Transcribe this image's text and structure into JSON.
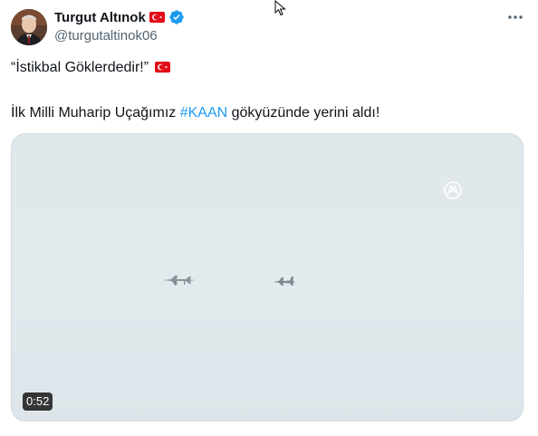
{
  "author": {
    "display_name": "Turgut Altınok",
    "handle": "@turgutaltinok06"
  },
  "tweet": {
    "line1": "“İstikbal Göklerdedir!”",
    "line2_prefix": "İlk Milli Muharip Uçağımız ",
    "hashtag": "#KAAN",
    "line2_suffix": " gökyüzünde yerini aldı!"
  },
  "media": {
    "duration": "0:52",
    "watermark_icon": "aa-logo-icon"
  },
  "icons": {
    "flag": "turkey-flag-icon",
    "verified": "verified-badge-icon",
    "more": "more-options-icon"
  },
  "colors": {
    "link": "#1d9bf0",
    "verified": "#1d9bf0",
    "flag": "#e30a17",
    "secondary_text": "#536471"
  }
}
